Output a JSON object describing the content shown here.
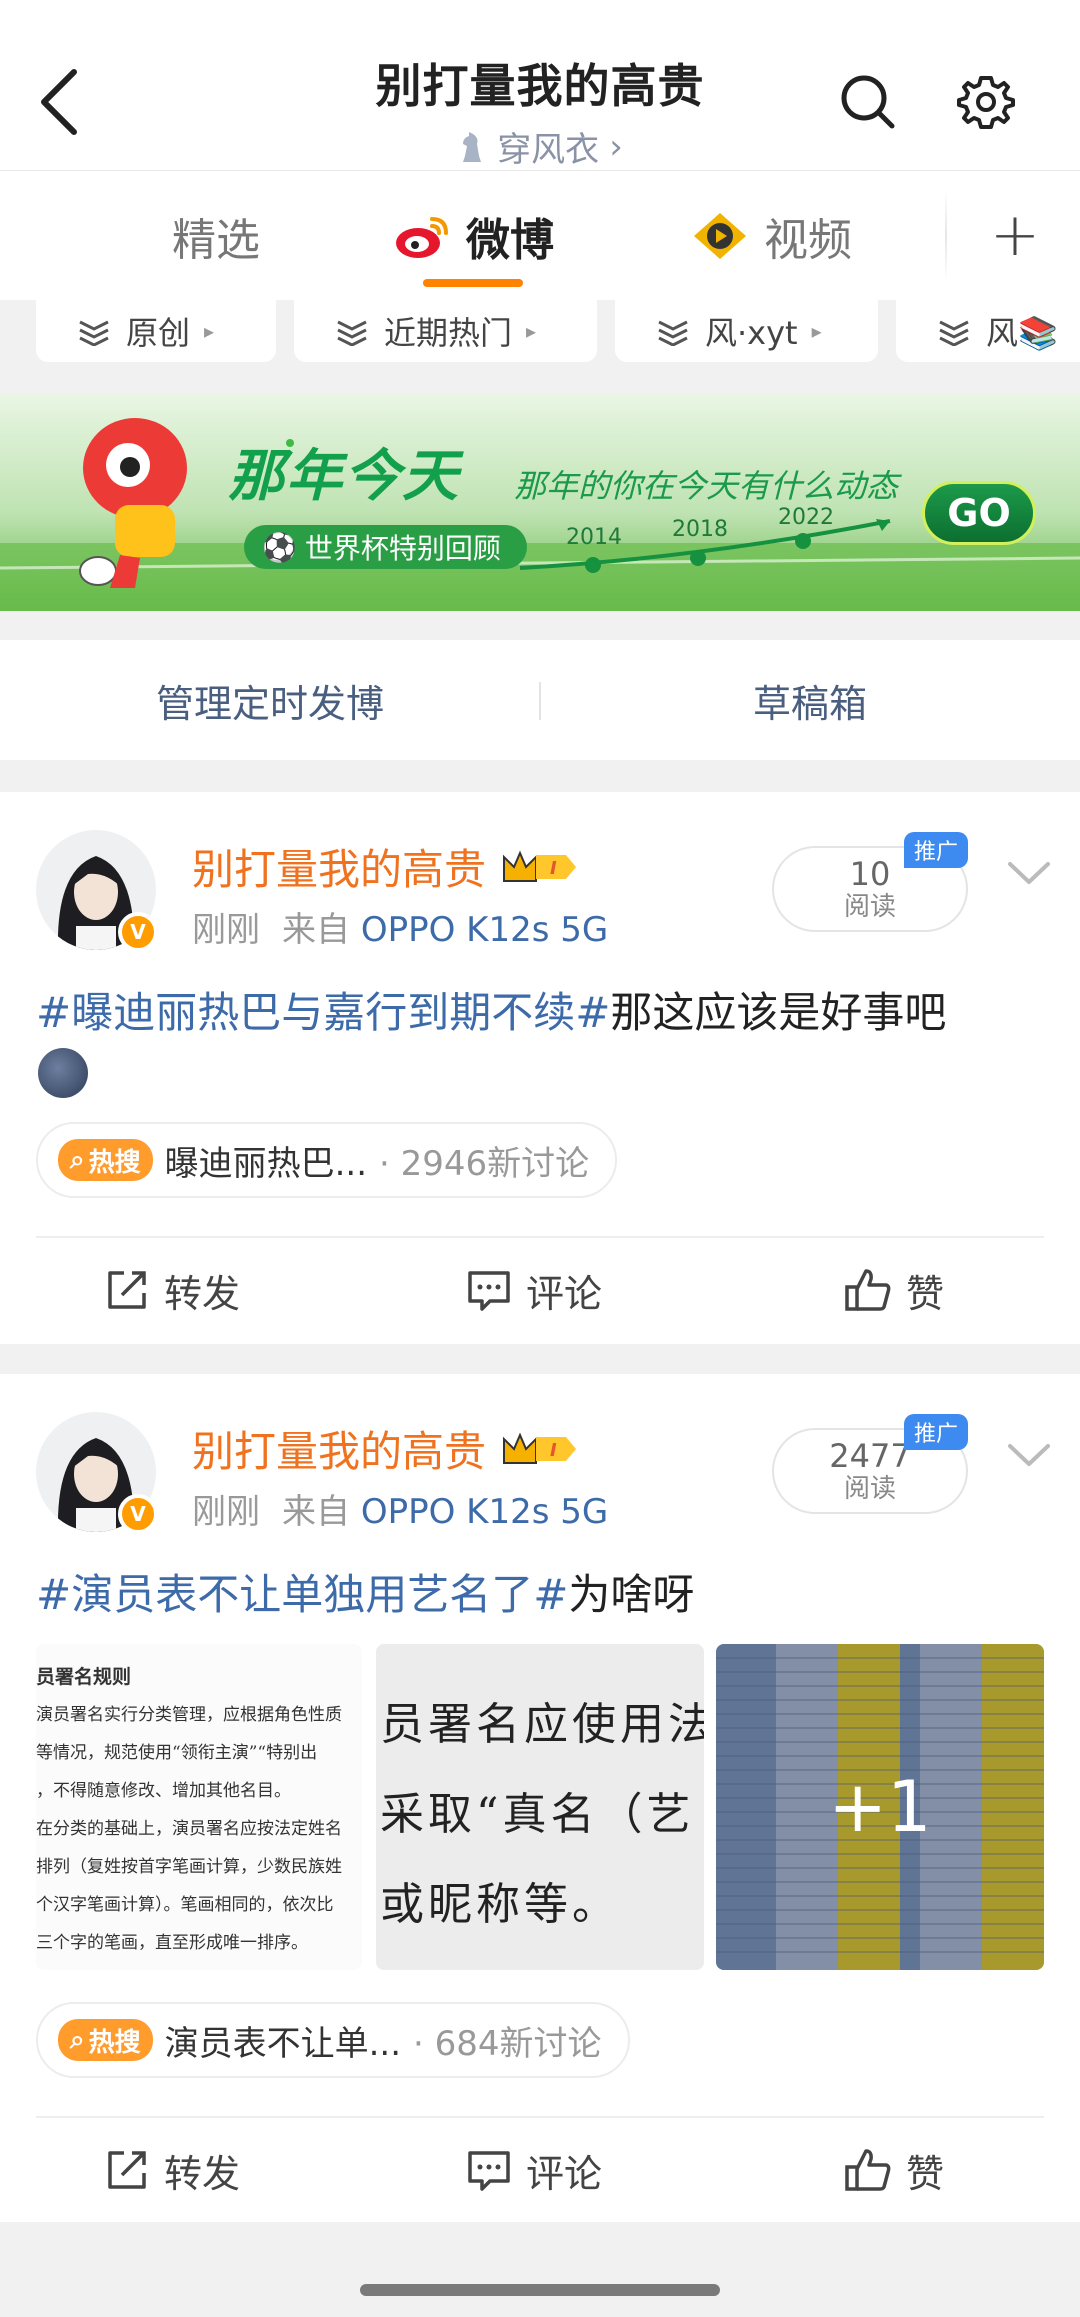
{
  "header": {
    "title": "别打量我的高贵",
    "subtitle": "穿风衣",
    "subtitle_chevron": "›"
  },
  "tabs": [
    {
      "label": "精选"
    },
    {
      "label": "微博"
    },
    {
      "label": "视频"
    }
  ],
  "tab_add": "+",
  "chips": [
    {
      "label": "原创"
    },
    {
      "label": "近期热门"
    },
    {
      "label": "风·xyt"
    },
    {
      "label": "风📚"
    }
  ],
  "banner": {
    "title": "那年今天",
    "slogan": "那年的你在今天有什么动态",
    "tag": "世界杯特别回顾",
    "years": [
      "2014",
      "2018",
      "2022"
    ],
    "go": "GO"
  },
  "manage": {
    "scheduled": "管理定时发博",
    "drafts": "草稿箱"
  },
  "posts": [
    {
      "author": "别打量我的高贵",
      "time": "刚刚",
      "from": "来自",
      "device": "OPPO K12s 5G",
      "reads": "10",
      "reads_label": "阅读",
      "promo": "推广",
      "topic": "#曝迪丽热巴与嘉行到期不续#",
      "text": "那这应该是好事吧",
      "hot_badge": "热搜",
      "hot_topic": "曝迪丽热巴...",
      "hot_count": "· 2946新讨论",
      "repost": "转发",
      "comment": "评论",
      "like": "赞"
    },
    {
      "author": "别打量我的高贵",
      "time": "刚刚",
      "from": "来自",
      "device": "OPPO K12s 5G",
      "reads": "2477",
      "reads_label": "阅读",
      "promo": "推广",
      "topic": "#演员表不让单独用艺名了#",
      "text": "为啥呀",
      "images": {
        "img1_lines": [
          "员署名规则",
          "演员署名实行分类管理，应根据角色性质",
          "等情况，规范使用“领衔主演”“特别出",
          "，不得随意修改、增加其他名目。",
          "在分类的基础上，演员署名应按法定姓名",
          "排列（复姓按首字笔画计算，少数民族姓",
          "个汉字笔画计算）。笔画相同的，依次比",
          "三个字的笔画，直至形成唯一排序。"
        ],
        "img2_lines": [
          "员署名应使用法",
          "采取“真名（艺",
          "或昵称等。"
        ],
        "more": "+1"
      },
      "hot_badge": "热搜",
      "hot_topic": "演员表不让单...",
      "hot_count": "· 684新讨论",
      "repost": "转发",
      "comment": "评论",
      "like": "赞"
    }
  ],
  "colors": {
    "accent_orange": "#ff8200",
    "author_orange": "#f0721f",
    "link_blue": "#3d6aa8",
    "promo_blue": "#3d8bf0"
  }
}
